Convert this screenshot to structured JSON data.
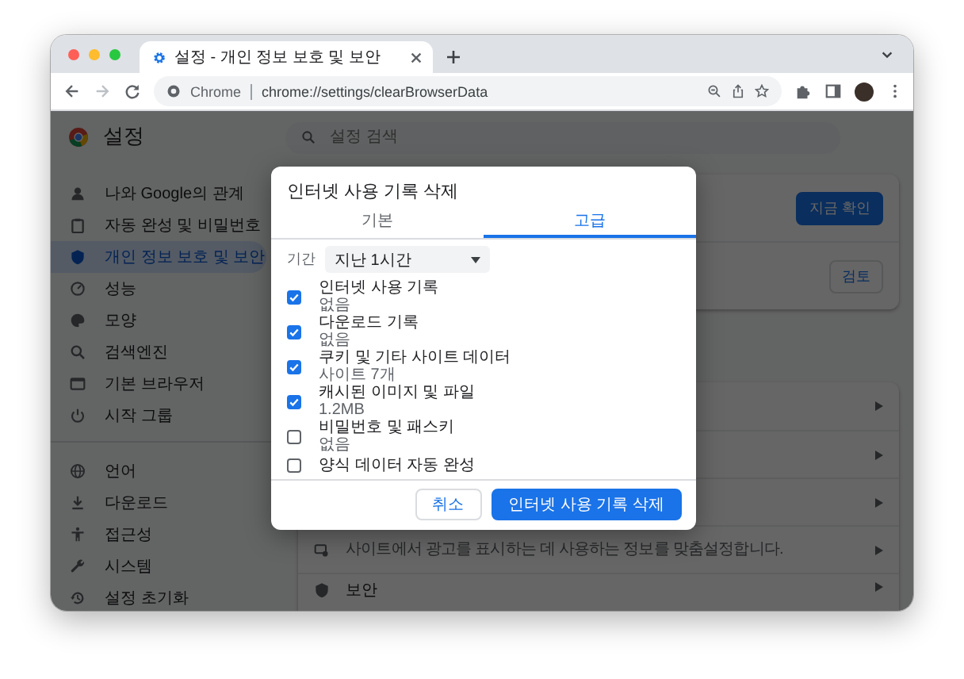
{
  "browser": {
    "tab": {
      "title": "설정 - 개인 정보 보호 및 보안"
    },
    "address_bar": {
      "site_label": "Chrome",
      "url": "chrome://settings/clearBrowserData"
    }
  },
  "settings": {
    "title": "설정",
    "search": {
      "placeholder": "설정 검색"
    },
    "sidebar": {
      "groups": [
        [
          {
            "label": "나와 Google의 관계",
            "kind": "person",
            "selected": false
          },
          {
            "label": "자동 완성 및 비밀번호",
            "kind": "clipboard",
            "selected": false
          },
          {
            "label": "개인 정보 보호 및 보안",
            "kind": "shield",
            "selected": true
          },
          {
            "label": "성능",
            "kind": "gauge",
            "selected": false
          },
          {
            "label": "모양",
            "kind": "palette",
            "selected": false
          },
          {
            "label": "검색엔진",
            "kind": "search",
            "selected": false
          },
          {
            "label": "기본 브라우저",
            "kind": "window",
            "selected": false
          },
          {
            "label": "시작 그룹",
            "kind": "power",
            "selected": false
          }
        ],
        [
          {
            "label": "언어",
            "kind": "globe",
            "selected": false
          },
          {
            "label": "다운로드",
            "kind": "download",
            "selected": false
          },
          {
            "label": "접근성",
            "kind": "accessibility",
            "selected": false
          },
          {
            "label": "시스템",
            "kind": "wrench",
            "selected": false
          },
          {
            "label": "설정 초기화",
            "kind": "history",
            "selected": false
          }
        ]
      ]
    },
    "safety_card": {
      "buttons": [
        {
          "label": "지금 확인",
          "kind": "primary"
        },
        {
          "label": "검토",
          "kind": "outline"
        }
      ]
    },
    "privacy_card": {
      "rows": [
        {
          "kind": "ads",
          "description": "사이트에서 광고를 표시하는 데 사용하는 정보를 맞춤설정합니다."
        },
        {
          "kind": "shield",
          "title": "보안"
        }
      ]
    }
  },
  "dialog": {
    "title": "인터넷 사용 기록 삭제",
    "tabs": [
      {
        "label": "기본",
        "selected": false
      },
      {
        "label": "고급",
        "selected": true
      }
    ],
    "period": {
      "label": "기간",
      "value": "지난 1시간"
    },
    "items": [
      {
        "label": "인터넷 사용 기록",
        "detail": "없음",
        "checked": true
      },
      {
        "label": "다운로드 기록",
        "detail": "없음",
        "checked": true
      },
      {
        "label": "쿠키 및 기타 사이트 데이터",
        "detail": "사이트 7개",
        "checked": true
      },
      {
        "label": "캐시된 이미지 및 파일",
        "detail": "1.2MB",
        "checked": true
      },
      {
        "label": "비밀번호 및 패스키",
        "detail": "없음",
        "checked": false
      },
      {
        "label": "양식 데이터 자동 완성",
        "checked": false
      }
    ],
    "buttons": [
      {
        "label": "취소",
        "kind": "secondary"
      },
      {
        "label": "인터넷 사용 기록 삭제",
        "kind": "primary"
      }
    ]
  }
}
